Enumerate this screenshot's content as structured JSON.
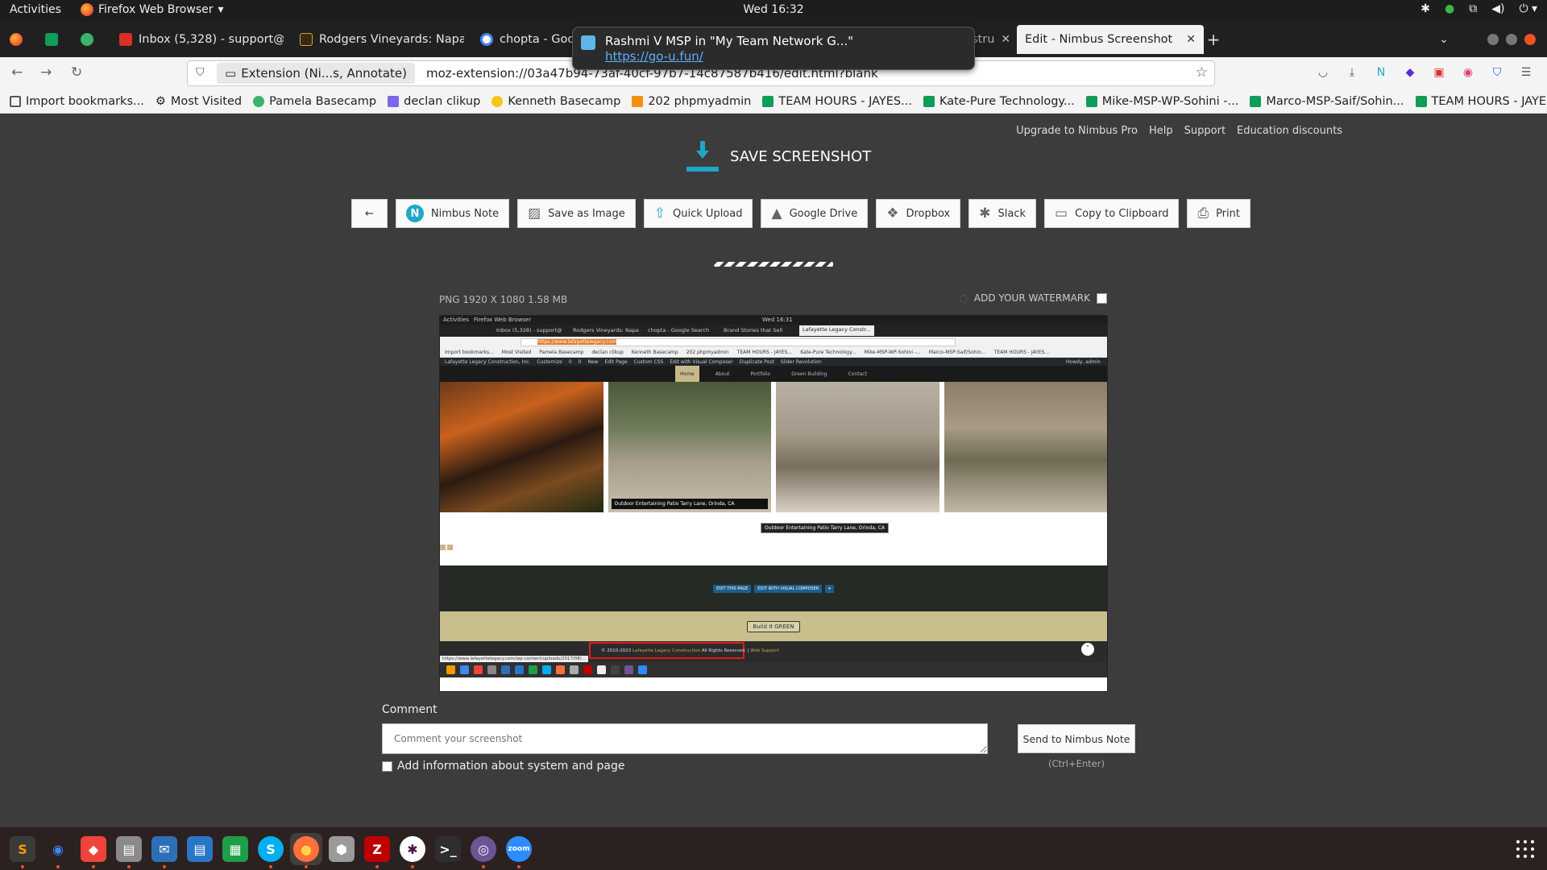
{
  "topbar": {
    "activities": "Activities",
    "app_name": "Firefox Web Browser",
    "clock": "Wed 16:32"
  },
  "tabs": [
    {
      "label": "Inbox (5,328) - support@",
      "icon": "gmail-icon",
      "color": "#d93025"
    },
    {
      "label": "Rodgers Vineyards: Napa",
      "icon": "vineyard-icon",
      "color": "#3a2a10"
    },
    {
      "label": "chopta - Goog",
      "icon": "google-icon",
      "color": "#4285f4"
    },
    {
      "label": "stru",
      "icon": "page-icon",
      "color": "#888888"
    },
    {
      "label": "Edit - Nimbus Screenshot",
      "icon": "nimbus-icon",
      "color": "#1fa6c9"
    }
  ],
  "notification": {
    "title": "Rashmi V MSP in \"My Team Network G...\"",
    "link": "https://go-u.fun/"
  },
  "navbar": {
    "identity": "Extension (Ni...s, Annotate)",
    "url": "moz-extension://03a47b94-73af-40cf-97b7-14c87587b416/edit.html?blank"
  },
  "bookmarks": [
    {
      "label": "Import bookmarks...",
      "color": "#555555"
    },
    {
      "label": "Most Visited",
      "color": "#555555"
    },
    {
      "label": "Pamela Basecamp",
      "color": "#3bb36a"
    },
    {
      "label": "declan clikup",
      "color": "#7b68ee"
    },
    {
      "label": "Kenneth Basecamp",
      "color": "#f5c518"
    },
    {
      "label": "202 phpmyadmin",
      "color": "#f29111"
    },
    {
      "label": "TEAM HOURS - JAYES...",
      "color": "#0f9d58"
    },
    {
      "label": "Kate-Pure Technology...",
      "color": "#0f9d58"
    },
    {
      "label": "Mike-MSP-WP-Sohini -...",
      "color": "#0f9d58"
    },
    {
      "label": "Marco-MSP-Saif/Sohin...",
      "color": "#0f9d58"
    },
    {
      "label": "TEAM HOURS - JAYES...",
      "color": "#0f9d58"
    }
  ],
  "page": {
    "top_links": [
      "Upgrade to Nimbus Pro",
      "Help",
      "Support",
      "Education discounts"
    ],
    "heading": "SAVE SCREENSHOT",
    "actions": {
      "back": "←",
      "nimbus_note": "Nimbus Note",
      "save_as_image": "Save as Image",
      "quick_upload": "Quick Upload",
      "google_drive": "Google Drive",
      "dropbox": "Dropbox",
      "slack": "Slack",
      "copy": "Copy to Clipboard",
      "print": "Print"
    },
    "meta": "PNG 1920 X 1080 1.58 MB",
    "watermark": "ADD YOUR WATERMARK",
    "comment_label": "Comment",
    "comment_placeholder": "Comment your screenshot",
    "send_button": "Send to Nimbus Note",
    "send_hint": "(Ctrl+Enter)",
    "add_info": "Add information about system and page"
  },
  "preview": {
    "topbar_left": "Activities",
    "topbar_app": "Firefox Web Browser",
    "clock": "Wed 16:31",
    "tabs": [
      "Inbox (5,328) - support@",
      "Rodgers Vineyards: Napa",
      "chopta - Google Search",
      "Brand Stories that Sell",
      "Lafayette Legacy Constr..."
    ],
    "url": "https://www.lafayettelegacy.com",
    "bookmarks": [
      "Import bookmarks...",
      "Most Visited",
      "Pamela Basecamp",
      "declan clikup",
      "Kenneth Basecamp",
      "202 phpmyadmin",
      "TEAM HOURS - JAYES...",
      "Kate-Pure Technology...",
      "Mike-MSP-WP-Sohini -...",
      "Marco-MSP-Saif/Sohin...",
      "TEAM HOURS - JAYES..."
    ],
    "admin_items": [
      "Lafayette Legacy Construction, Inc.",
      "Customize",
      "0",
      "0",
      "New",
      "Edit Page",
      "Custom CSS",
      "Edit with Visual Composer",
      "Duplicate Post",
      "Slider Revolution"
    ],
    "admin_right": "Howdy, admin",
    "menu": [
      "Home",
      "About",
      "Portfolio",
      "Green Building",
      "Contact"
    ],
    "caption": "Outdoor Entertaining Patio Tarry Lane, Orinda, CA",
    "tooltip": "Outdoor Entertaining Patio Tarry Lane, Orinda, CA",
    "btn_edit_page": "EDIT THIS PAGE",
    "btn_edit_vc": "EDIT WITH VISUAL COMPOSER",
    "logo": "Build It GREEN",
    "footer_text": "© 2010-2023",
    "footer_company": "Lafayette Legacy Construction",
    "footer_rights": "All Rights Reserved. |",
    "footer_support": "Web Support",
    "status_url": "https://www.lafayettelegacy.com/wp-content/uploads/2017/08/..."
  },
  "dock": [
    {
      "name": "sublime-text-icon",
      "color": "#3a3a3a",
      "glyph": "S",
      "fg": "#ff9800"
    },
    {
      "name": "chrome-icon",
      "color": "#2c2121",
      "glyph": "◉",
      "fg": "#4285f4"
    },
    {
      "name": "anydesk-icon",
      "color": "#ef443b",
      "glyph": "◆",
      "fg": "#ffffff"
    },
    {
      "name": "files-icon",
      "color": "#8a8a8a",
      "glyph": "▤",
      "fg": "#ffffff"
    },
    {
      "name": "thunderbird-icon",
      "color": "#2c6fb7",
      "glyph": "✉",
      "fg": "#ffffff"
    },
    {
      "name": "writer-icon",
      "color": "#2a76c6",
      "glyph": "▤",
      "fg": "#ffffff"
    },
    {
      "name": "calc-icon",
      "color": "#1e9d4a",
      "glyph": "▦",
      "fg": "#ffffff"
    },
    {
      "name": "skype-icon",
      "color": "#00aff0",
      "glyph": "S",
      "fg": "#ffffff"
    },
    {
      "name": "firefox-icon",
      "color": "#ff7139",
      "glyph": "●",
      "fg": "#ffd34a"
    },
    {
      "name": "shield-app-icon",
      "color": "#9a9a9a",
      "glyph": "⬢",
      "fg": "#ffffff"
    },
    {
      "name": "filezilla-icon",
      "color": "#bf0000",
      "glyph": "Z",
      "fg": "#ffffff"
    },
    {
      "name": "slack-icon",
      "color": "#ffffff",
      "glyph": "✱",
      "fg": "#4a154b"
    },
    {
      "name": "terminal-icon",
      "color": "#2e2e2e",
      "glyph": ">_",
      "fg": "#ffffff"
    },
    {
      "name": "github-icon",
      "color": "#6e5494",
      "glyph": "◎",
      "fg": "#ffffff"
    },
    {
      "name": "zoom-icon",
      "color": "#2d8cff",
      "glyph": "zoom",
      "fg": "#ffffff"
    }
  ]
}
